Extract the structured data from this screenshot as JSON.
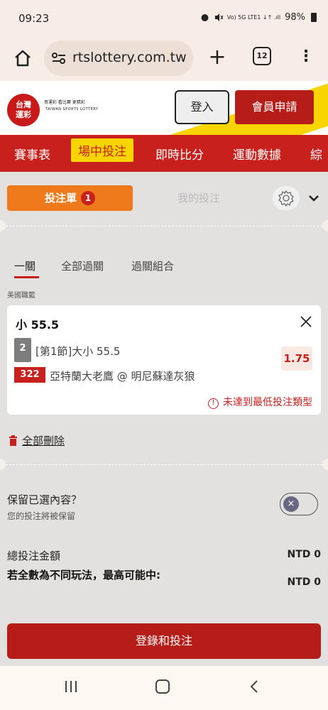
{
  "status_bar": {
    "time": "09:23",
    "indicators": "Vo) 5G LTE1 ↓↑ .ıll",
    "battery": "98%"
  },
  "browser": {
    "url": "rtslottery.com.tw",
    "tab_count": "12",
    "icons": [
      "home-icon",
      "tune-icon",
      "plus-icon",
      "tabs-icon",
      "more-vert-icon"
    ]
  },
  "site_header": {
    "logo_line1": "台灣",
    "logo_line2": "運彩",
    "tagline": "買運彩 看比賽 更精彩",
    "logo_sub": "TAIWAN SPORTS LOTTERY",
    "login_label": "登入",
    "register_label": "會員申請"
  },
  "nav": {
    "items": [
      {
        "label": "賽事表"
      },
      {
        "label": "場中投注"
      },
      {
        "label": "即時比分"
      },
      {
        "label": "運動數據"
      },
      {
        "label": "綜"
      }
    ],
    "active_index": 1
  },
  "bet_slip": {
    "tab_active_label": "投注單",
    "tab_active_count": "1",
    "tab_inactive_label": "我的投注",
    "subtabs": [
      {
        "label": "一關"
      },
      {
        "label": "全部過關"
      },
      {
        "label": "過關組合"
      }
    ],
    "league": "美國職籃",
    "bet": {
      "title": "小 55.5",
      "period_num": "2",
      "market": "[第1節]大小 55.5",
      "odds": "1.75",
      "game_code": "322",
      "teams": "亞特蘭大老鷹 @ 明尼蘇達灰狼",
      "warning": "未達到最低投注類型"
    },
    "delete_all_label": "全部刪除",
    "keep_title": "保留已選內容？",
    "keep_sub": "您的投注將被保留",
    "keep_enabled": false,
    "total_label": "總投注金額",
    "total_value": "NTD 0",
    "maxwin_label": "若全數為不同玩法，最高可能中:",
    "maxwin_value": "NTD 0",
    "submit_label": "登錄和投注"
  },
  "colors": {
    "brand_red": "#c8201d",
    "accent_orange": "#ee7a1c",
    "accent_yellow": "#f8d500"
  }
}
